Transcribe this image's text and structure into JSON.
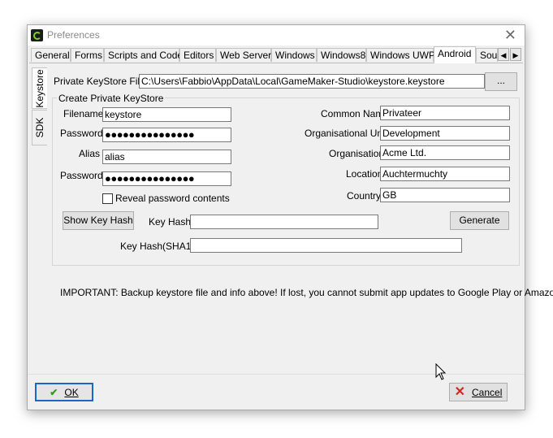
{
  "window": {
    "title": "Preferences"
  },
  "tabs": [
    "General",
    "Forms",
    "Scripts and Code",
    "Editors",
    "Web Server",
    "Windows",
    "Windows8",
    "Windows UWP",
    "Android",
    "Sou"
  ],
  "active_tab": "Android",
  "side_tabs": [
    "Keystore",
    "SDK"
  ],
  "keystore": {
    "file_label": "Private KeyStore File",
    "file_value": "C:\\Users\\Fabbio\\AppData\\Local\\GameMaker-Studio\\keystore.keystore",
    "browse_label": "...",
    "group_title": "Create Private KeyStore",
    "filename_label": "Filename",
    "filename_value": "keystore",
    "password_label": "Password",
    "password_value": "●●●●●●●●●●●●●●●",
    "alias_label": "Alias",
    "alias_value": "alias",
    "password2_label": "Password",
    "password2_value": "●●●●●●●●●●●●●●●",
    "reveal_label": "Reveal password contents",
    "common_name_label": "Common Name",
    "common_name_value": "Privateer",
    "org_unit_label": "Organisational Unit",
    "org_unit_value": "Development",
    "organisation_label": "Organisation",
    "organisation_value": "Acme Ltd.",
    "location_label": "Location",
    "location_value": "Auchtermuchty",
    "country_label": "Country",
    "country_value": "GB",
    "show_key_hash_label": "Show Key Hash",
    "key_hash_label": "Key Hash",
    "key_hash_value": "",
    "generate_label": "Generate",
    "key_hash_sha1_label": "Key Hash(SHA1)",
    "key_hash_sha1_value": "",
    "important_text": "IMPORTANT: Backup keystore file and info above! If lost, you cannot submit app updates to Google Play or Amazon."
  },
  "footer": {
    "ok_label": "OK",
    "cancel_label": "Cancel"
  },
  "colors": {
    "window_bg": "#f0f0f0",
    "ok_border": "#1a66c9",
    "check_green": "#2e9e1f",
    "cancel_red": "#d12a1f"
  }
}
